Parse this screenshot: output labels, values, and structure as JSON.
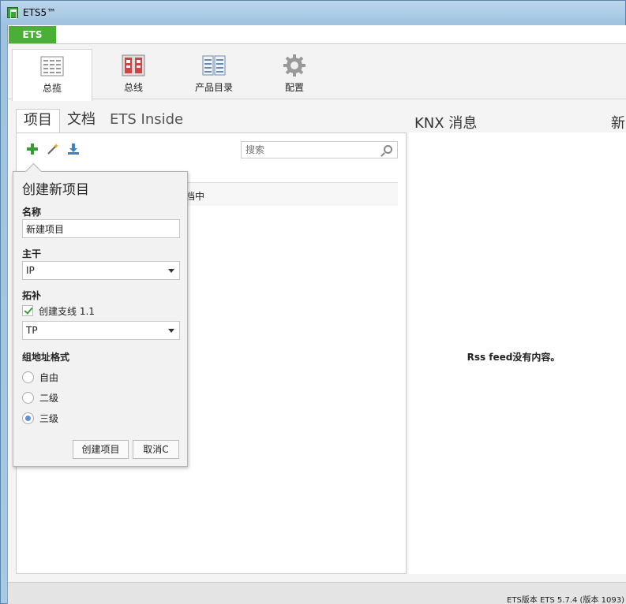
{
  "window": {
    "title": "ETS5™"
  },
  "menubar": {
    "ets_tab": "ETS"
  },
  "ribbon": {
    "items": [
      {
        "label": "总揽",
        "icon": "overview-icon"
      },
      {
        "label": "总线",
        "icon": "bus-icon"
      },
      {
        "label": "产品目录",
        "icon": "catalog-icon"
      },
      {
        "label": "配置",
        "icon": "settings-gear-icon"
      }
    ]
  },
  "tabs": [
    {
      "label": "项目"
    },
    {
      "label": "文档"
    },
    {
      "label": "ETS Inside"
    }
  ],
  "knx": {
    "title": "KNX 消息",
    "empty": "Rss feed没有内容。"
  },
  "news": {
    "title": "新闻"
  },
  "project_list": {
    "search_placeholder": "搜索",
    "row_text": "档中"
  },
  "popup": {
    "title": "创建新项目",
    "name_label": "名称",
    "name_value": "新建项目",
    "backbone_label": "主干",
    "backbone_value": "IP",
    "topology_label": "拓补",
    "create_line_label": "创建支线 1.1",
    "create_line_checked": true,
    "medium_value": "TP",
    "ga_format_label": "组地址格式",
    "ga_options": [
      {
        "label": "自由",
        "checked": false
      },
      {
        "label": "二级",
        "checked": false
      },
      {
        "label": "三级",
        "checked": true
      }
    ],
    "create_button": "创建项目",
    "cancel_button": "取消C"
  },
  "status": {
    "text": "ETS版本 ETS 5.7.4 (版本 1093)"
  }
}
